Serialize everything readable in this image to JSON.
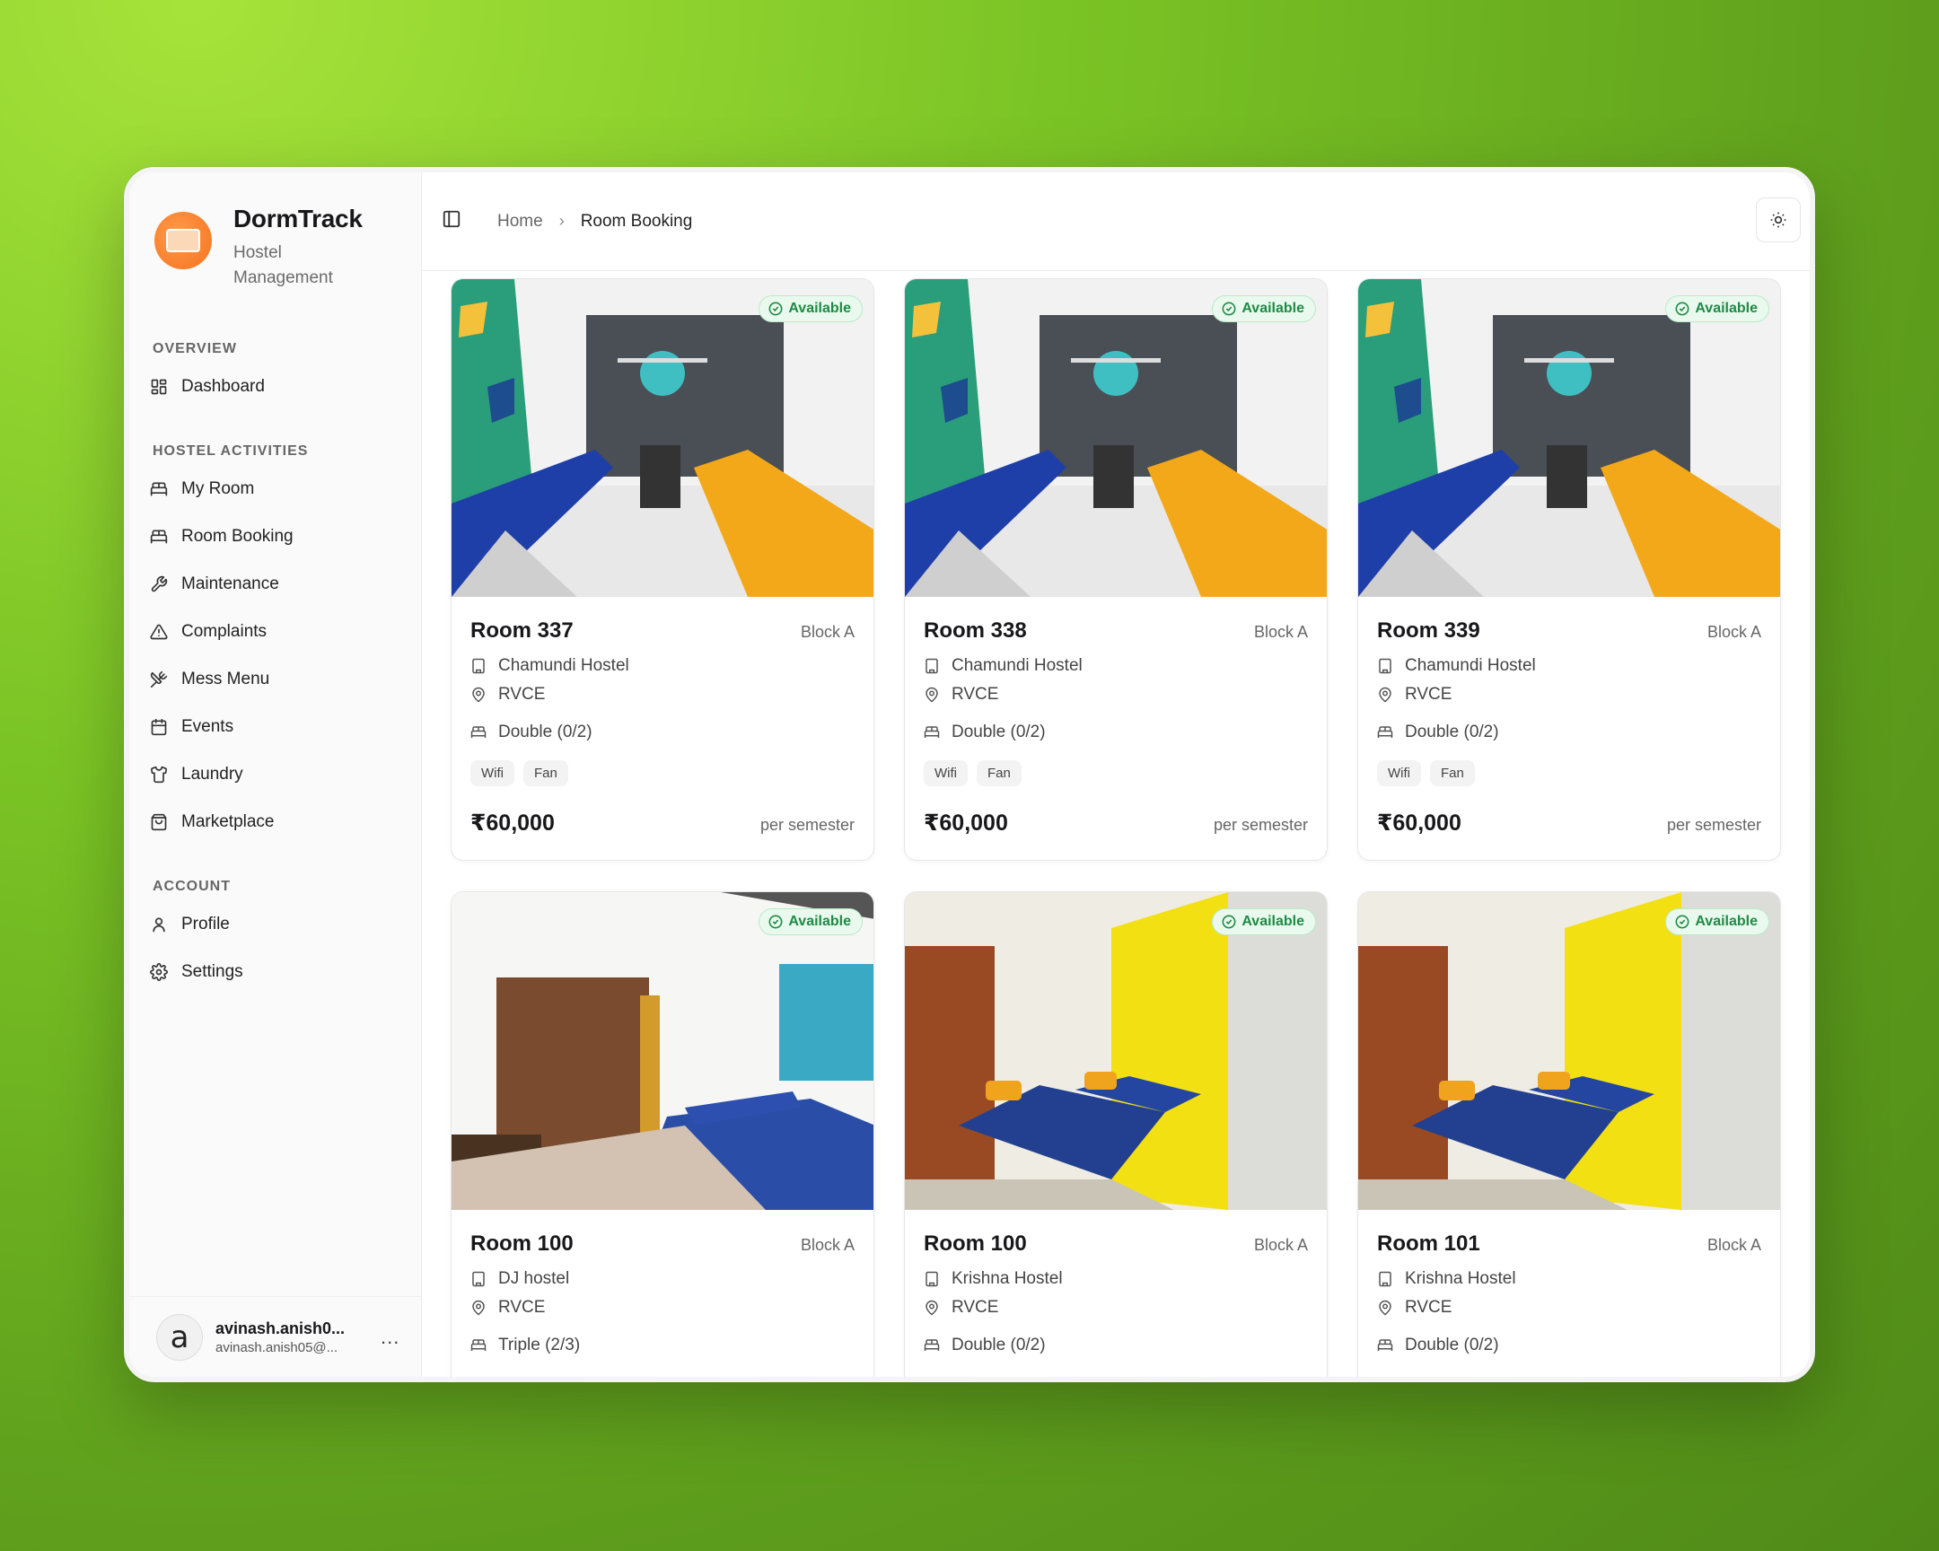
{
  "app": {
    "title": "DormTrack",
    "subtitle": "Hostel Management"
  },
  "sidebar": {
    "groups": [
      {
        "label": "OVERVIEW",
        "items": [
          {
            "label": "Dashboard",
            "icon": "dashboard-icon"
          }
        ]
      },
      {
        "label": "HOSTEL ACTIVITIES",
        "items": [
          {
            "label": "My Room",
            "icon": "bed-icon"
          },
          {
            "label": "Room Booking",
            "icon": "bed-icon"
          },
          {
            "label": "Maintenance",
            "icon": "wrench-icon"
          },
          {
            "label": "Complaints",
            "icon": "alert-triangle-icon"
          },
          {
            "label": "Mess Menu",
            "icon": "utensils-icon"
          },
          {
            "label": "Events",
            "icon": "calendar-icon"
          },
          {
            "label": "Laundry",
            "icon": "shirt-icon"
          },
          {
            "label": "Marketplace",
            "icon": "shopping-bag-icon"
          }
        ]
      },
      {
        "label": "ACCOUNT",
        "items": [
          {
            "label": "Profile",
            "icon": "user-icon"
          },
          {
            "label": "Settings",
            "icon": "gear-icon"
          }
        ]
      }
    ],
    "user": {
      "avatar_letter": "a",
      "name": "avinash.anish0...",
      "email": "avinash.anish05@...",
      "more": "..."
    }
  },
  "header": {
    "breadcrumb": {
      "home": "Home",
      "separator": "›",
      "current": "Room Booking"
    }
  },
  "rooms": [
    {
      "name": "Room 337",
      "block": "Block A",
      "hostel": "Chamundi Hostel",
      "college": "RVCE",
      "occupancy": "Double (0/2)",
      "amenities": [
        "Wifi",
        "Fan"
      ],
      "price": "₹60,000",
      "period": "per semester",
      "status": "Available"
    },
    {
      "name": "Room 338",
      "block": "Block A",
      "hostel": "Chamundi Hostel",
      "college": "RVCE",
      "occupancy": "Double (0/2)",
      "amenities": [
        "Wifi",
        "Fan"
      ],
      "price": "₹60,000",
      "period": "per semester",
      "status": "Available"
    },
    {
      "name": "Room 339",
      "block": "Block A",
      "hostel": "Chamundi Hostel",
      "college": "RVCE",
      "occupancy": "Double (0/2)",
      "amenities": [
        "Wifi",
        "Fan"
      ],
      "price": "₹60,000",
      "period": "per semester",
      "status": "Available"
    },
    {
      "name": "Room 100",
      "block": "Block A",
      "hostel": "DJ hostel",
      "college": "RVCE",
      "occupancy": "Triple (2/3)",
      "amenities": [],
      "price": "",
      "period": "",
      "status": "Available"
    },
    {
      "name": "Room 100",
      "block": "Block A",
      "hostel": "Krishna Hostel",
      "college": "RVCE",
      "occupancy": "Double (0/2)",
      "amenities": [],
      "price": "",
      "period": "",
      "status": "Available"
    },
    {
      "name": "Room 101",
      "block": "Block A",
      "hostel": "Krishna Hostel",
      "college": "RVCE",
      "occupancy": "Double (0/2)",
      "amenities": [],
      "price": "",
      "period": "",
      "status": "Available"
    }
  ],
  "colors": {
    "available_bg": "#e9f9ee",
    "available_text": "#1f8a45",
    "brand_orange": "#f47420"
  }
}
